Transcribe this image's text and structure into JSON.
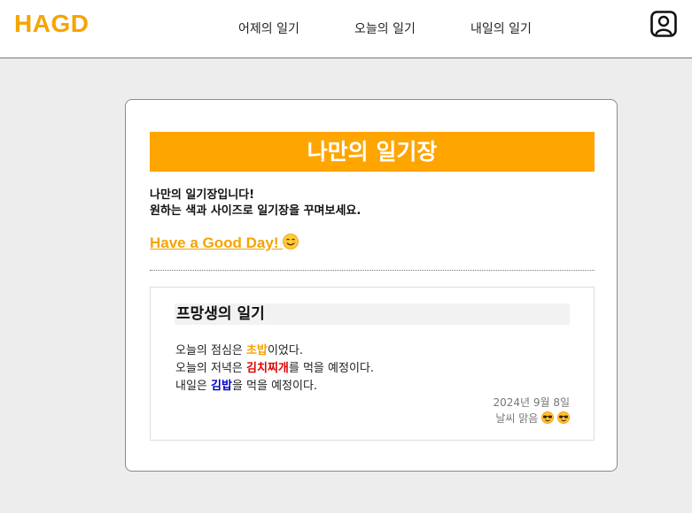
{
  "header": {
    "logo": "HAGD",
    "nav": [
      "어제의 일기",
      "오늘의 일기",
      "내일의 일기"
    ],
    "profile_icon": "user-profile-icon"
  },
  "card": {
    "banner_title": "나만의 일기장",
    "intro_line1": "나만의 일기장입니다!",
    "intro_line2": "원하는 색과 사이즈로 일기장을 꾸며보세요.",
    "greeting": "Have a Good Day!",
    "greeting_icon": "smiling-face-icon"
  },
  "diary": {
    "title": "프망생의 일기",
    "line1": {
      "prefix": "오늘의 점심은 ",
      "food": "초밥",
      "suffix": "이었다."
    },
    "line2": {
      "prefix": "오늘의 저녁은 ",
      "food": "김치찌개",
      "suffix": "를 먹을 예정이다."
    },
    "line3": {
      "prefix": "내일은 ",
      "food": "김밥",
      "suffix": "을 먹을 예정이다."
    },
    "date": "2024년 9월 8일",
    "weather": "날씨 맑음",
    "weather_icons": [
      "sunglasses-face-icon",
      "sunglasses-face-icon"
    ]
  },
  "colors": {
    "accent": "#ffa500",
    "lunch_food": "#f5a400",
    "dinner_food": "#e00000",
    "tomorrow_food": "#0000cc"
  }
}
